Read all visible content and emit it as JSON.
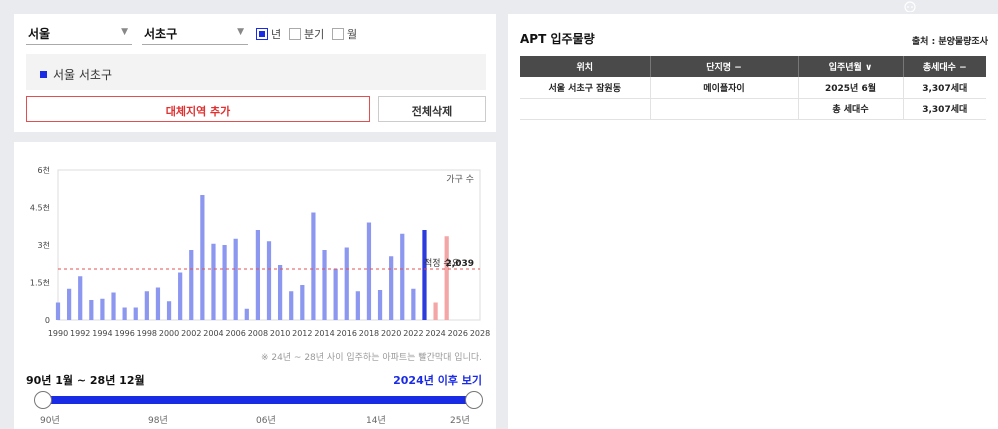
{
  "filters": {
    "city": "서울",
    "district": "서초구",
    "periods": [
      {
        "label": "년",
        "checked": true
      },
      {
        "label": "분기",
        "checked": false
      },
      {
        "label": "월",
        "checked": false
      }
    ]
  },
  "selected_region": "서울 서초구",
  "buttons": {
    "add": "대체지역 추가",
    "delete_all": "전체삭제"
  },
  "chart_data": {
    "type": "bar",
    "legend": "가구 수",
    "yticks": [
      "6천",
      "4.5천",
      "3천",
      "1.5천",
      "0"
    ],
    "ylim": [
      0,
      6000
    ],
    "xticks": [
      "1990",
      "1992",
      "1994",
      "1996",
      "1998",
      "2000",
      "2002",
      "2004",
      "2006",
      "2008",
      "2010",
      "2012",
      "2014",
      "2016",
      "2018",
      "2020",
      "2022",
      "2024",
      "2026",
      "2028"
    ],
    "x": [
      1990,
      1991,
      1992,
      1993,
      1994,
      1995,
      1996,
      1997,
      1998,
      1999,
      2000,
      2001,
      2002,
      2003,
      2004,
      2005,
      2006,
      2007,
      2008,
      2009,
      2010,
      2011,
      2012,
      2013,
      2014,
      2015,
      2016,
      2017,
      2018,
      2019,
      2020,
      2021,
      2022,
      2023,
      2024,
      2025
    ],
    "values": [
      700,
      1250,
      1750,
      800,
      850,
      1100,
      500,
      500,
      1150,
      1300,
      750,
      1900,
      2800,
      5000,
      3050,
      3000,
      3250,
      450,
      3600,
      3150,
      2200,
      1150,
      1400,
      4300,
      2800,
      2050,
      2900,
      1150,
      3900,
      1200,
      2550,
      3450,
      1250,
      3600,
      700,
      3350
    ],
    "highlight_current": 2023,
    "future_from": 2024,
    "reference_line": {
      "label": "적정 수요",
      "value_text": "2,039",
      "value": 2039
    },
    "colors": {
      "past": "#8c97f0",
      "current": "#2b3bdc",
      "future": "#f4a5a5",
      "reference": "#e05050"
    }
  },
  "note": "※ 24년 ~ 28년 사이 입주하는 아파트는 빨간막대 입니다.",
  "range": {
    "label": "90년 1월 ~ 28년 12월",
    "link": "2024년 이후 보기"
  },
  "slider": {
    "labels": [
      "90년",
      "98년",
      "06년",
      "14년",
      "25년"
    ],
    "start_fraction": 0.0,
    "end_fraction": 1.0
  },
  "table": {
    "title": "APT 입주물량",
    "source": "출처 : 분양물량조사",
    "headers": [
      "위치",
      "단지명 −",
      "입주년월 ∨",
      "총세대수 −"
    ],
    "rows": [
      [
        "서울 서초구 잠원동",
        "메이플자이",
        "2025년 6월",
        "3,307세대"
      ],
      [
        "",
        "",
        "총 세대수",
        "3,307세대"
      ]
    ]
  }
}
